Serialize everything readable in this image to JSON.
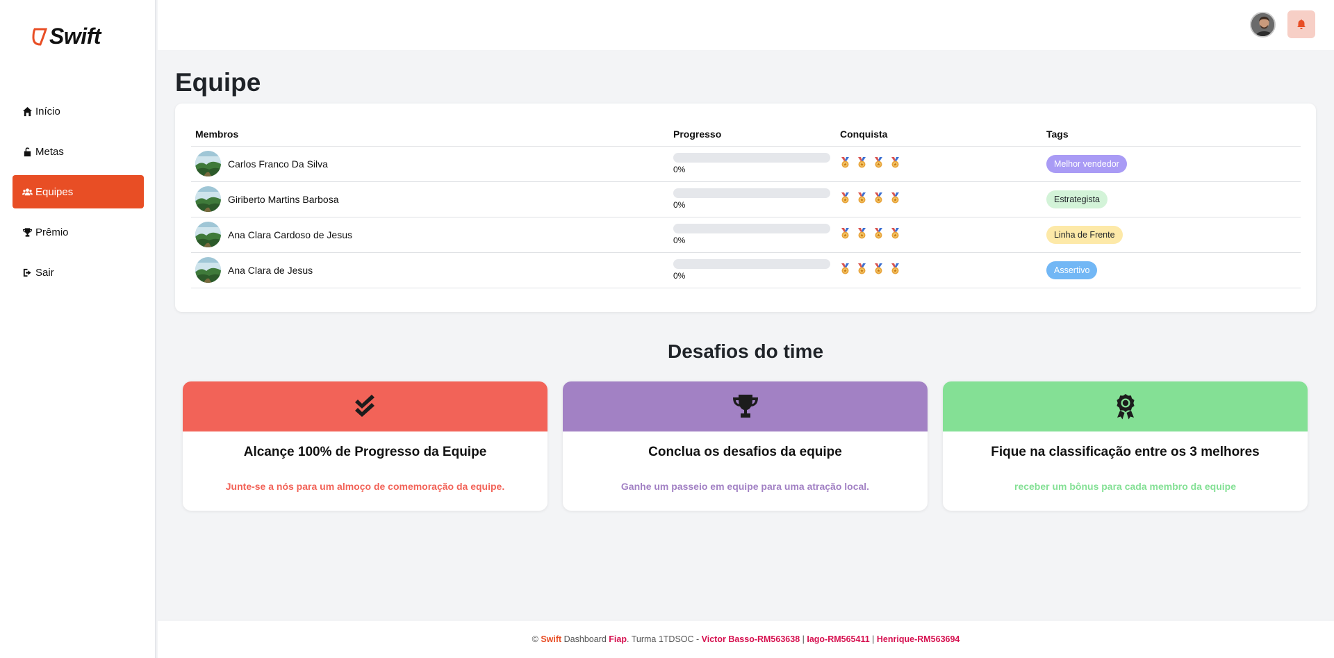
{
  "brand": {
    "name": "Swift",
    "accent": "#e84e25"
  },
  "sidebar": {
    "items": [
      {
        "label": "Início",
        "icon": "home-icon",
        "active": false
      },
      {
        "label": "Metas",
        "icon": "unlock-icon",
        "active": false
      },
      {
        "label": "Equipes",
        "icon": "users-icon",
        "active": true
      },
      {
        "label": "Prêmio",
        "icon": "trophy-icon",
        "active": false
      },
      {
        "label": "Sair",
        "icon": "sign-out-icon",
        "active": false
      }
    ]
  },
  "topbar": {
    "avatar": "user-avatar",
    "notification_icon": "bell-icon"
  },
  "page": {
    "title": "Equipe"
  },
  "team_table": {
    "headers": {
      "members": "Membros",
      "progress": "Progresso",
      "achievement": "Conquista",
      "tags": "Tags"
    },
    "rows": [
      {
        "name": "Carlos Franco Da Silva",
        "progress": 0,
        "progress_text": "0%",
        "medals": 4,
        "tag": "Melhor vendedor",
        "tag_bg": "#a99bf5",
        "tag_color": "#ffffff"
      },
      {
        "name": "Giriberto Martins Barbosa",
        "progress": 0,
        "progress_text": "0%",
        "medals": 4,
        "tag": "Estrategista",
        "tag_bg": "#d3f3d8",
        "tag_color": "#1f2328"
      },
      {
        "name": "Ana Clara Cardoso de Jesus",
        "progress": 0,
        "progress_text": "0%",
        "medals": 4,
        "tag": "Linha de Frente",
        "tag_bg": "#fde9a8",
        "tag_color": "#1f2328"
      },
      {
        "name": "Ana Clara de Jesus",
        "progress": 0,
        "progress_text": "0%",
        "medals": 4,
        "tag": "Assertivo",
        "tag_bg": "#72b7f5",
        "tag_color": "#ffffff"
      }
    ]
  },
  "challenges": {
    "title": "Desafios do time",
    "cards": [
      {
        "icon": "double-check-icon",
        "header_color": "#f26358",
        "title": "Alcançe 100% de Progresso da Equipe",
        "reward": "Junte-se a nós para um almoço de comemoração da equipe.",
        "reward_color": "#f26358"
      },
      {
        "icon": "trophy-icon",
        "header_color": "#a281c4",
        "title": "Conclua os desafios da equipe",
        "reward": "Ganhe um passeio em equipe para uma atração local.",
        "reward_color": "#a281c4"
      },
      {
        "icon": "award-icon",
        "header_color": "#84e095",
        "title": "Fique na classificação entre os 3 melhores",
        "reward": "receber um bônus para cada membro da equipe",
        "reward_color": "#84e095"
      }
    ]
  },
  "footer": {
    "copyright": "©",
    "brand": "Swift",
    "text1": " Dashboard ",
    "school": "Fiap",
    "text2": ". Turma 1TDSOC - ",
    "author1": "Victor Basso-RM563638",
    "sep1": " | ",
    "author2": "Iago-RM565411",
    "sep2": " | ",
    "author3": "Henrique-RM563694"
  }
}
